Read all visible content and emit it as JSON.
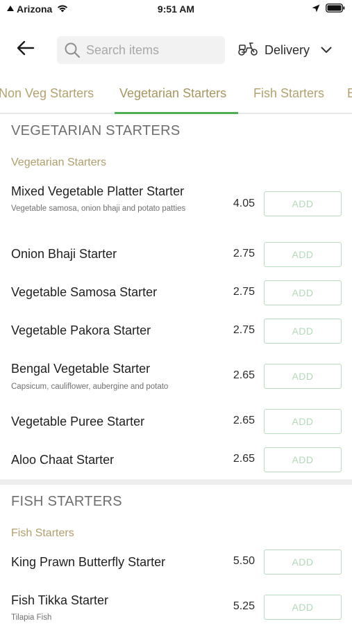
{
  "status_bar": {
    "carrier": "Arizona",
    "time": "9:51 AM"
  },
  "header": {
    "search_placeholder": "Search items",
    "delivery_label": "Delivery"
  },
  "tabs": [
    {
      "label": "Non Veg Starters"
    },
    {
      "label": "Vegetarian Starters",
      "active": true
    },
    {
      "label": "Fish Starters"
    },
    {
      "label": "B"
    }
  ],
  "sections": [
    {
      "heading": "VEGETARIAN STARTERS",
      "subheading": "Vegetarian Starters",
      "items": [
        {
          "name": "Mixed Vegetable Platter Starter",
          "desc": "Vegetable samosa, onion bhaji and potato patties",
          "price": "4.05",
          "add_label": "ADD"
        },
        {
          "name": "Onion Bhaji Starter",
          "price": "2.75",
          "add_label": "ADD"
        },
        {
          "name": "Vegetable Samosa Starter",
          "price": "2.75",
          "add_label": "ADD"
        },
        {
          "name": "Vegetable Pakora Starter",
          "price": "2.75",
          "add_label": "ADD"
        },
        {
          "name": "Bengal Vegetable Starter",
          "desc": "Capsicum, cauliflower, aubergine and potato",
          "price": "2.65",
          "add_label": "ADD"
        },
        {
          "name": "Vegetable Puree Starter",
          "price": "2.65",
          "add_label": "ADD"
        },
        {
          "name": "Aloo Chaat Starter",
          "price": "2.65",
          "add_label": "ADD"
        }
      ]
    },
    {
      "heading": "FISH STARTERS",
      "subheading": "Fish Starters",
      "items": [
        {
          "name": "King Prawn Butterfly Starter",
          "price": "5.50",
          "add_label": "ADD"
        },
        {
          "name": "Fish Tikka Starter",
          "desc": "Tilapia Fish",
          "price": "5.25",
          "add_label": "ADD"
        }
      ]
    }
  ],
  "colors": {
    "accent": "#4caf50",
    "gold": "#b09e6a",
    "add_border": "#b9dcc0"
  },
  "icons": [
    "signal-icon",
    "wifi-icon",
    "location-arrow-icon",
    "battery-icon",
    "back-arrow-icon",
    "search-icon",
    "scooter-icon",
    "chevron-down-icon"
  ]
}
